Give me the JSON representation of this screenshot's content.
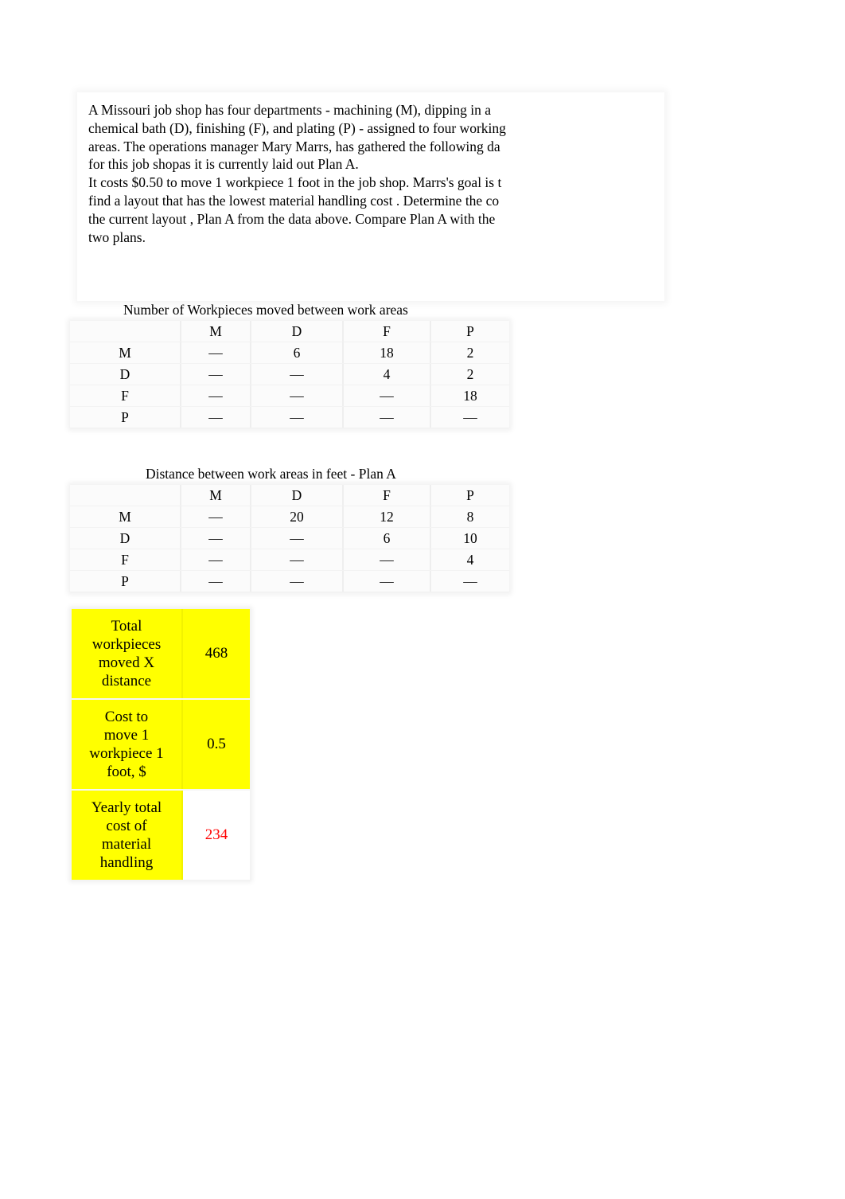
{
  "problem_text": {
    "lines": [
      "A Missouri job shop has four departments - machining (M), dipping in a",
      "chemical bath (D), finishing (F), and plating (P) - assigned to four working",
      "areas. The operations manager Mary Marrs, has gathered the following da",
      "for this job shopas it is currently laid out Plan A.",
      "It costs $0.50 to move 1 workpiece 1 foot in the job shop. Marrs's goal is t",
      "find a layout that has the lowest material handling cost . Determine the co",
      "the current layout , Plan A from the data above. Compare Plan A with the",
      "two plans."
    ]
  },
  "workpieces_table": {
    "title": "Number of Workpieces moved between work areas",
    "columns": [
      "",
      "M",
      "D",
      "F",
      "P"
    ],
    "rows": [
      [
        "M",
        "—",
        "6",
        "18",
        "2"
      ],
      [
        "D",
        "—",
        "—",
        "4",
        "2"
      ],
      [
        "F",
        "—",
        "—",
        "—",
        "18"
      ],
      [
        "P",
        "—",
        "—",
        "—",
        "—"
      ]
    ]
  },
  "distance_table": {
    "title": "Distance between work areas in feet - Plan A",
    "columns": [
      "",
      "M",
      "D",
      "F",
      "P"
    ],
    "rows": [
      [
        "M",
        "—",
        "20",
        "12",
        "8"
      ],
      [
        "D",
        "—",
        "—",
        "6",
        "10"
      ],
      [
        "F",
        "—",
        "—",
        "—",
        "4"
      ],
      [
        "P",
        "—",
        "—",
        "—",
        "—"
      ]
    ]
  },
  "summary": {
    "rows": [
      {
        "label": "Total\nworkpieces\nmoved X\ndistance",
        "value": "468"
      },
      {
        "label": "Cost to\nmove 1\nworkpiece 1\nfoot, $",
        "value": "0.5"
      },
      {
        "label": "Yearly total\ncost of\nmaterial\nhandling",
        "value": "234"
      }
    ],
    "colors": {
      "highlight": "#ffff00",
      "result_text": "#ff0000"
    }
  }
}
